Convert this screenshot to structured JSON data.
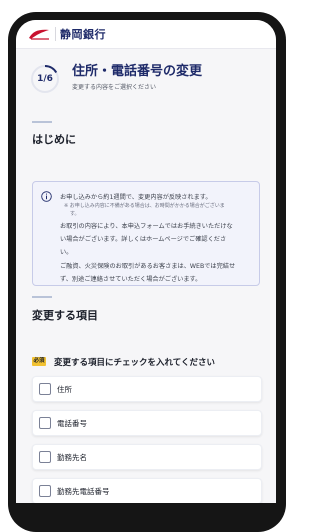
{
  "header": {
    "bank_name": "静岡銀行",
    "logo_icon": "bank-logo-icon",
    "brand_color": "#c8102e"
  },
  "progress": {
    "current_step": 1,
    "total_steps": 6,
    "label": "1/6"
  },
  "page": {
    "title": "住所・電話番号の変更",
    "subtitle": "変更する内容をご選択ください"
  },
  "intro": {
    "heading": "はじめに",
    "icon": "info-icon",
    "lines": [
      "お申し込みから約1週間で、変更内容が反映されます。",
      "お取引の内容により、本申込フォームではお手続きいただけな",
      "い場合がございます。詳しくはホームページでご確認くださ",
      "い。",
      "ご融資、火災保険のお取引があるお客さまは、WEBでは完結せ",
      "ず、別途ご連絡させていただく場合がございます。"
    ],
    "notes": [
      "※ お申し込み内容に不備がある場合は、お時間がかかる場合がございま",
      "す。"
    ]
  },
  "change_items": {
    "heading": "変更する項目",
    "required_badge": "必須",
    "instruction": "変更する項目にチェックを入れてください",
    "options": [
      {
        "label": "住所",
        "checked": false
      },
      {
        "label": "電話番号",
        "checked": false
      },
      {
        "label": "勤務先名",
        "checked": false
      },
      {
        "label": "勤務先電話番号",
        "checked": false
      }
    ]
  },
  "colors": {
    "accent": "#1f2b6a",
    "required": "#f2c232",
    "info_box_bg": "#f2f3fb",
    "info_box_border": "#c7cbe8"
  }
}
